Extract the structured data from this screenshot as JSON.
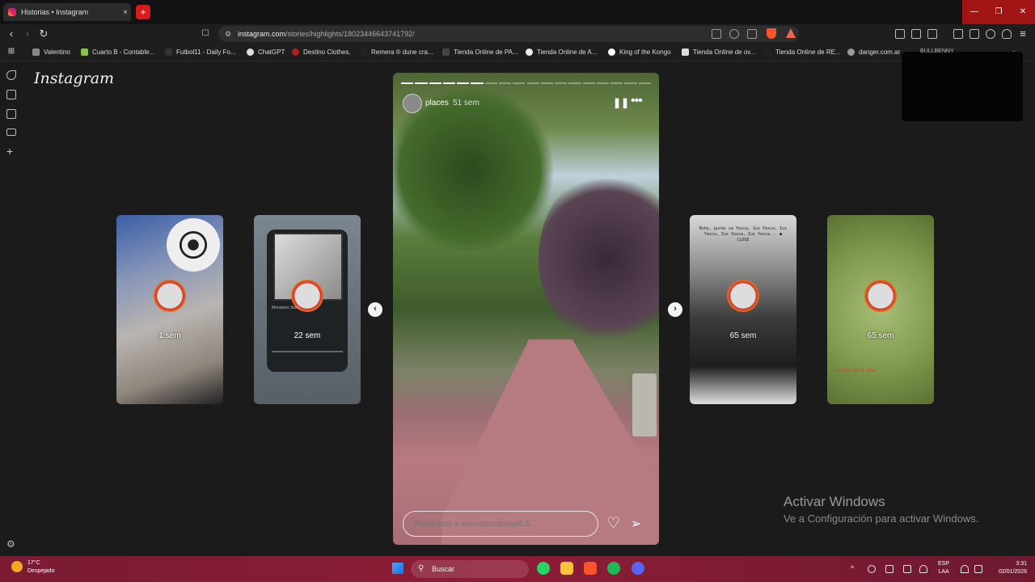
{
  "browser": {
    "tab_title": "Historias • Instagram",
    "tab_close": "×",
    "new_tab": "+",
    "window_controls": [
      "—",
      "❐",
      "✕"
    ],
    "url_host": "instagram.com",
    "url_path": "/stories/highlights/18023446643741792/"
  },
  "bookmarks": [
    {
      "label": "Valentino",
      "color": "#777777"
    },
    {
      "label": "Cuarto B - Contable...",
      "color": "#8bc34a"
    },
    {
      "label": "Futbol11 - Daily Fo...",
      "color": "#333333"
    },
    {
      "label": "ChatGPT",
      "color": "#dddddd"
    },
    {
      "label": "Destino Clothes.",
      "color": "#b71c1c"
    },
    {
      "label": "Remera ® dune cra...",
      "color": "#222222"
    },
    {
      "label": "Tienda Online de PA...",
      "color": "#444444"
    },
    {
      "label": "Tienda Online de A...",
      "color": "#eeeeee"
    },
    {
      "label": "King of the Kongo",
      "color": "#ffffff"
    },
    {
      "label": "Tienda Online de ov...",
      "color": "#dddddd"
    },
    {
      "label": "Tienda Online de RE...",
      "color": "#222222"
    },
    {
      "label": "danger.com.ar",
      "color": "#999999"
    }
  ],
  "popup_text": "BULLBENNY",
  "instagram": {
    "logo": "Instagram",
    "main_story": {
      "username": "places",
      "time_ago": "51 sem",
      "reply_placeholder": "Responde a axxeldiscotekaa6.5...",
      "progress_segments": 18,
      "active_segment": 6
    },
    "side_stories": [
      {
        "time_ago": "1 sem"
      },
      {
        "time_ago": "22 sem",
        "music_title": "Monsterio Ilumi..."
      },
      {
        "time_ago": "65 sem",
        "overlay_text": "Bohy, purés va Yesca, Ius Yesca, Ius Yesca, Ius Yesca, Ius Yesca... ● CLOSE"
      },
      {
        "time_ago": "65 sem",
        "caption": "el amor de mi vida"
      }
    ]
  },
  "watermark": {
    "title": "Activar Windows",
    "subtitle": "Ve a Configuración para activar Windows."
  },
  "taskbar": {
    "weather_temp": "17°C",
    "weather_desc": "Despejado",
    "search_label": "Buscar",
    "lang_line1": "ESP",
    "lang_line2": "LAA",
    "time": "3:31",
    "date": "02/01/2026"
  }
}
